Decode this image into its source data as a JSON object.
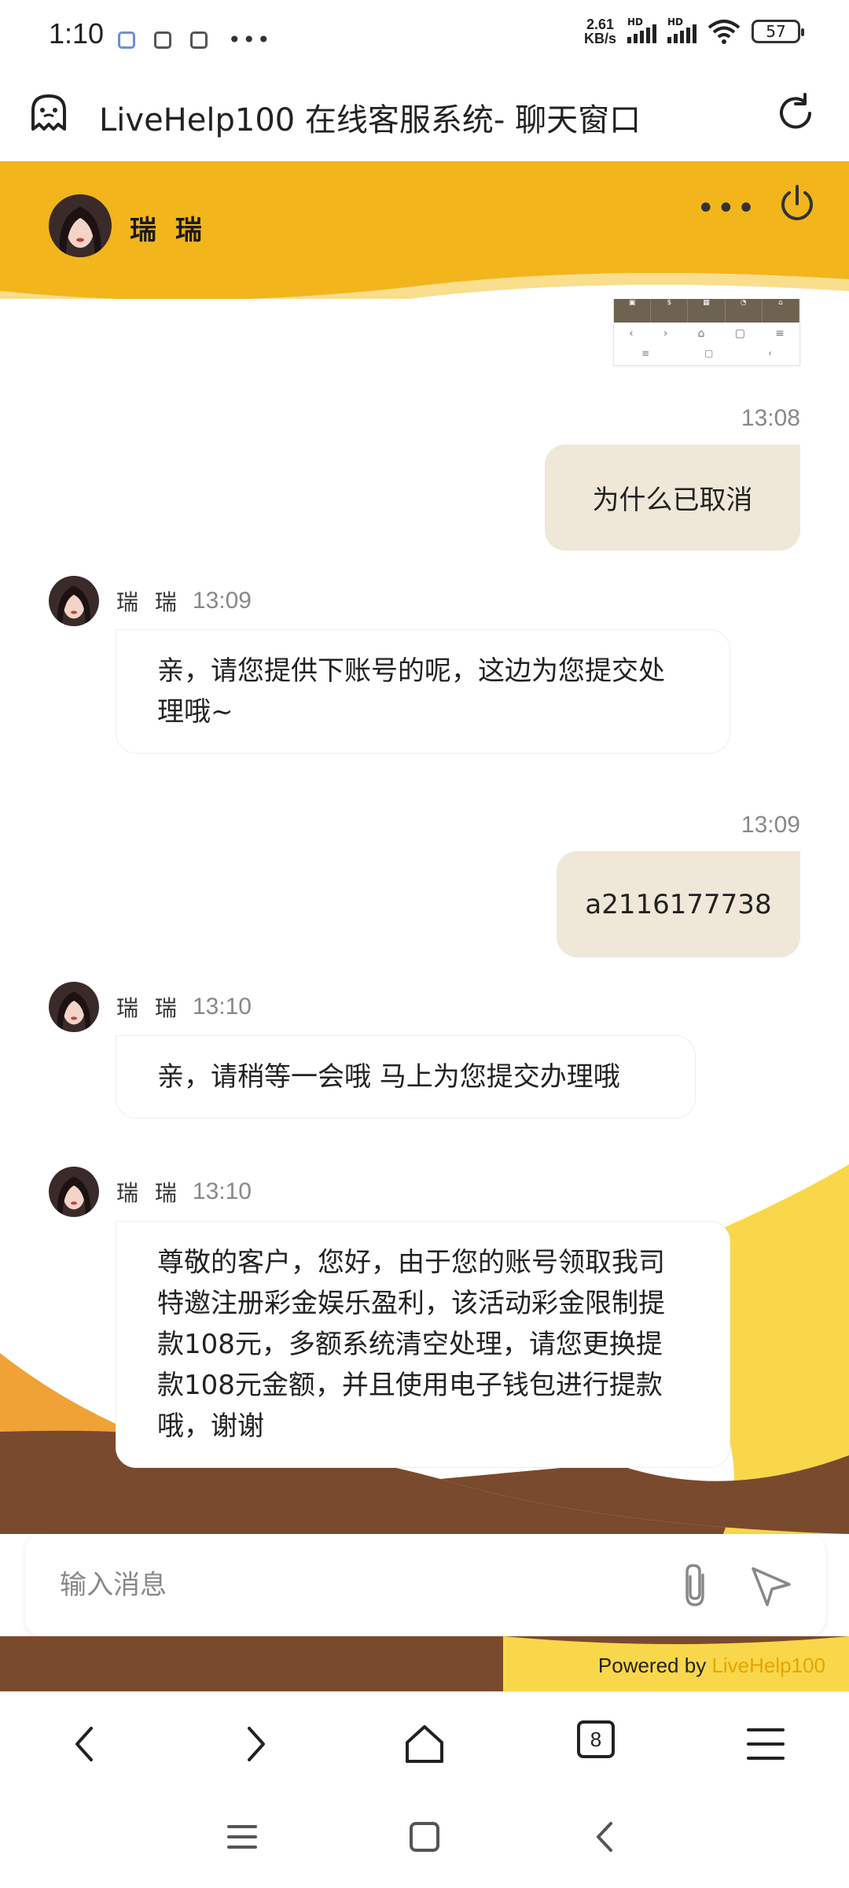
{
  "status_bar": {
    "time": "1:10",
    "speed_value": "2.61",
    "speed_unit": "KB/s",
    "signal_label_1": "HD",
    "signal_label_2": "HD",
    "battery": "57"
  },
  "browser": {
    "title": "LiveHelp100 在线客服系统- 聊天窗口",
    "tab_count": "8"
  },
  "chat": {
    "agent_name": "瑞 瑞",
    "messages": [
      {
        "direction": "out",
        "time": "13:08",
        "text": "为什么已取消"
      },
      {
        "direction": "in",
        "sender": "瑞 瑞",
        "time": "13:09",
        "text": "亲，请您提供下账号的呢，这边为您提交处理哦~"
      },
      {
        "direction": "out",
        "time": "13:09",
        "text": "a2116177738"
      },
      {
        "direction": "in",
        "sender": "瑞 瑞",
        "time": "13:10",
        "text": "亲，请稍等一会哦 马上为您提交办理哦"
      },
      {
        "direction": "in",
        "sender": "瑞 瑞",
        "time": "13:10",
        "text": "尊敬的客户，您好，由于您的账号领取我司特邀注册彩金娱乐盈利，该活动彩金限制提款108元，多额系统清空处理，请您更换提款108元金额，并且使用电子钱包进行提款哦，谢谢"
      }
    ]
  },
  "input": {
    "placeholder": "输入消息"
  },
  "footer": {
    "powered_by": "Powered by",
    "brand": "LiveHelp100"
  },
  "colors": {
    "header_yellow": "#f2b51c",
    "bubble_out": "#efe8d8",
    "brand_orange": "#e6a400",
    "bg_brown": "#7a4a2e"
  }
}
